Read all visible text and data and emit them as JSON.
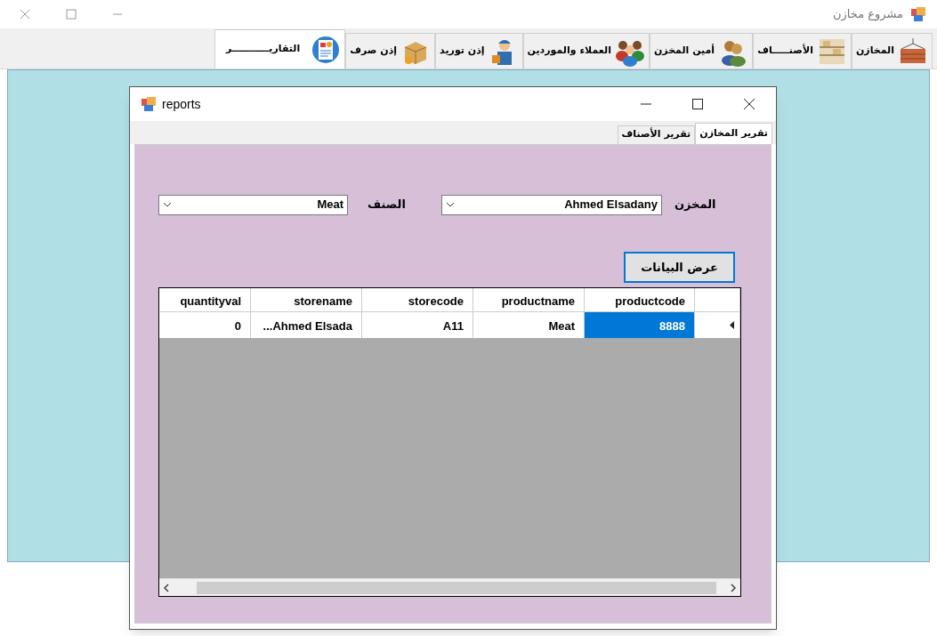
{
  "window": {
    "title": "مشروع مخازن"
  },
  "tabs": [
    {
      "label": "المخازن",
      "selected": false
    },
    {
      "label": "الأصنـــــاف",
      "selected": false
    },
    {
      "label": "أمين المخزن",
      "selected": false
    },
    {
      "label": "العملاء والموردين",
      "selected": false
    },
    {
      "label": "إذن توريد",
      "selected": false
    },
    {
      "label": "إذن صرف",
      "selected": false
    },
    {
      "label": "التقاريـــــــــــر",
      "selected": true
    }
  ],
  "dialog": {
    "title": "reports",
    "tabs": [
      {
        "label": "تقرير المخازن",
        "selected": true
      },
      {
        "label": "تقرير الأصناف",
        "selected": false
      }
    ],
    "store_label": "المخزن",
    "store_value": "Ahmed Elsadany",
    "item_label": "الصنف",
    "item_value": "Meat",
    "show_button": "عرض البيانات",
    "table": {
      "columns": [
        "productcode",
        "productname",
        "storecode",
        "storename",
        "quantityval"
      ],
      "rows": [
        {
          "current": true,
          "cells": [
            {
              "text": "8888",
              "selected": true
            },
            {
              "text": "Meat",
              "selected": false
            },
            {
              "text": "A11",
              "selected": false
            },
            {
              "text": "...Ahmed Elsada",
              "selected": false
            },
            {
              "text": "0",
              "selected": false
            }
          ]
        }
      ]
    }
  }
}
